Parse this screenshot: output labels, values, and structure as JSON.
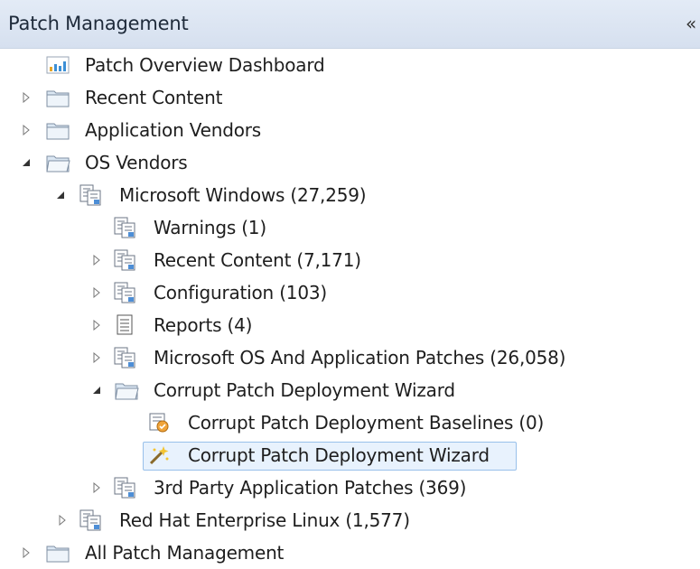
{
  "panel": {
    "title": "Patch Management",
    "collapse_glyph": "«"
  },
  "tree": {
    "items": [
      {
        "label": "Patch Overview Dashboard",
        "icon": "dashboard-chart-icon",
        "expander": "none"
      },
      {
        "label": "Recent Content",
        "icon": "folder-icon",
        "expander": "collapsed"
      },
      {
        "label": "Application Vendors",
        "icon": "folder-icon",
        "expander": "collapsed"
      },
      {
        "label": "OS Vendors",
        "icon": "folder-open-icon",
        "expander": "expanded"
      },
      {
        "label": "Microsoft Windows (27,259)",
        "icon": "content-group-icon",
        "expander": "expanded"
      },
      {
        "label": "Warnings (1)",
        "icon": "content-group-icon",
        "expander": "none"
      },
      {
        "label": "Recent Content (7,171)",
        "icon": "content-group-icon",
        "expander": "collapsed"
      },
      {
        "label": "Configuration (103)",
        "icon": "content-group-icon",
        "expander": "collapsed"
      },
      {
        "label": "Reports (4)",
        "icon": "report-list-icon",
        "expander": "collapsed"
      },
      {
        "label": "Microsoft OS And Application Patches (26,058)",
        "icon": "content-group-icon",
        "expander": "collapsed"
      },
      {
        "label": "Corrupt Patch Deployment Wizard",
        "icon": "folder-open-icon",
        "expander": "expanded"
      },
      {
        "label": "Corrupt Patch Deployment Baselines (0)",
        "icon": "baseline-icon",
        "expander": "none"
      },
      {
        "label": "Corrupt Patch Deployment Wizard",
        "icon": "wizard-wand-icon",
        "expander": "none",
        "selected": true
      },
      {
        "label": "3rd Party Application Patches (369)",
        "icon": "content-group-icon",
        "expander": "collapsed"
      },
      {
        "label": "Red Hat Enterprise Linux (1,577)",
        "icon": "content-group-icon",
        "expander": "collapsed"
      },
      {
        "label": "All Patch Management",
        "icon": "folder-icon",
        "expander": "collapsed"
      }
    ]
  }
}
